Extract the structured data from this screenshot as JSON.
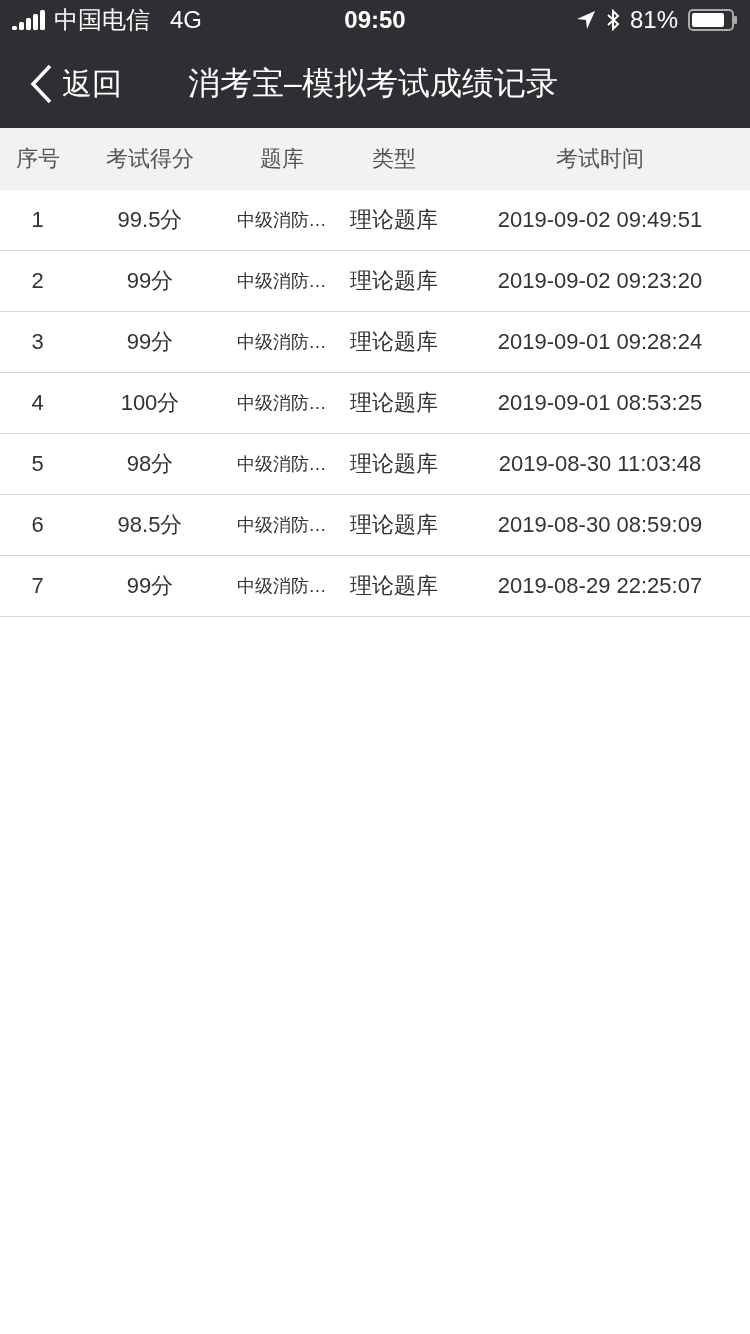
{
  "status_bar": {
    "carrier": "中国电信",
    "network": "4G",
    "time": "09:50",
    "battery": "81%"
  },
  "nav_bar": {
    "back": "返回",
    "title": "消考宝–模拟考试成绩记录"
  },
  "table": {
    "columns": [
      "序号",
      "考试得分",
      "题库",
      "类型",
      "考试时间"
    ],
    "rows": [
      [
        "1",
        "99.5分",
        "中级消防…",
        "理论题库",
        "2019-09-02 09:49:51"
      ],
      [
        "2",
        "99分",
        "中级消防…",
        "理论题库",
        "2019-09-02 09:23:20"
      ],
      [
        "3",
        "99分",
        "中级消防…",
        "理论题库",
        "2019-09-01 09:28:24"
      ],
      [
        "4",
        "100分",
        "中级消防…",
        "理论题库",
        "2019-09-01 08:53:25"
      ],
      [
        "5",
        "98分",
        "中级消防…",
        "理论题库",
        "2019-08-30 11:03:48"
      ],
      [
        "6",
        "98.5分",
        "中级消防…",
        "理论题库",
        "2019-08-30 08:59:09"
      ],
      [
        "7",
        "99分",
        "中级消防…",
        "理论题库",
        "2019-08-29 22:25:07"
      ]
    ]
  }
}
